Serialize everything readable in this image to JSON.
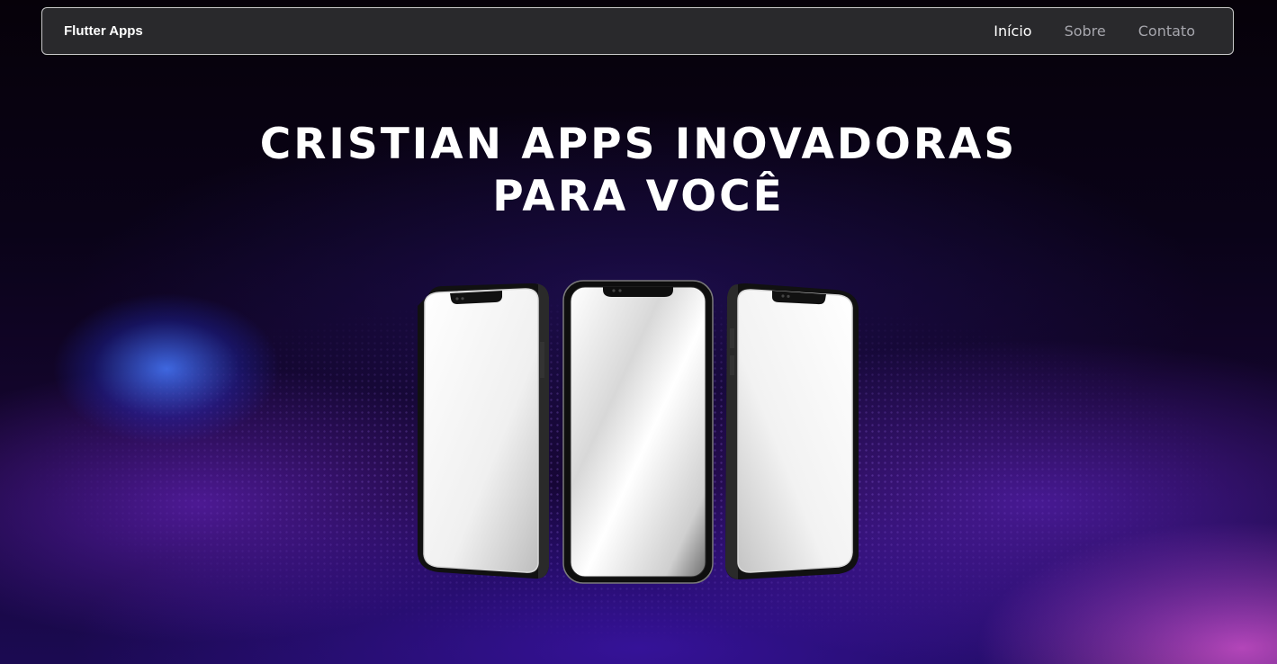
{
  "navbar": {
    "brand": "Flutter Apps",
    "links": [
      {
        "label": "Início",
        "active": true
      },
      {
        "label": "Sobre",
        "active": false
      },
      {
        "label": "Contato",
        "active": false
      }
    ]
  },
  "hero": {
    "title_line1": "CRISTIAN APPS INOVADORAS",
    "title_line2": "PARA VOCÊ"
  },
  "colors": {
    "background": "#07020f",
    "navbar_bg": "#2d2c30",
    "nav_inactive": "#a6a6ad",
    "accent_purple": "#6a28dc"
  }
}
